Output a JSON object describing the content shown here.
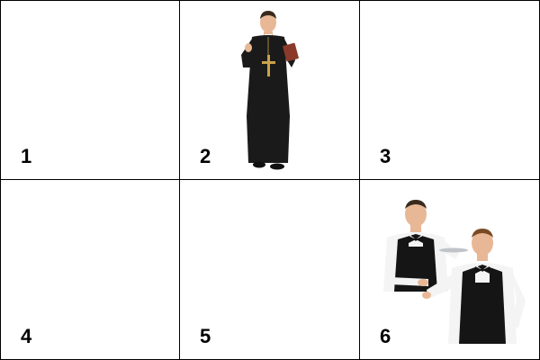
{
  "panels": [
    {
      "number": "1",
      "image": ""
    },
    {
      "number": "2",
      "image": "priest"
    },
    {
      "number": "3",
      "image": ""
    },
    {
      "number": "4",
      "image": ""
    },
    {
      "number": "5",
      "image": ""
    },
    {
      "number": "6",
      "image": "waiters"
    }
  ],
  "colors": {
    "border": "#000000",
    "background": "#ffffff",
    "robe": "#1a1a1a",
    "cross": "#c9a24a",
    "book": "#8b3a2a",
    "skin": "#e8b896",
    "vest": "#151515",
    "shirt": "#f4f4f4"
  }
}
